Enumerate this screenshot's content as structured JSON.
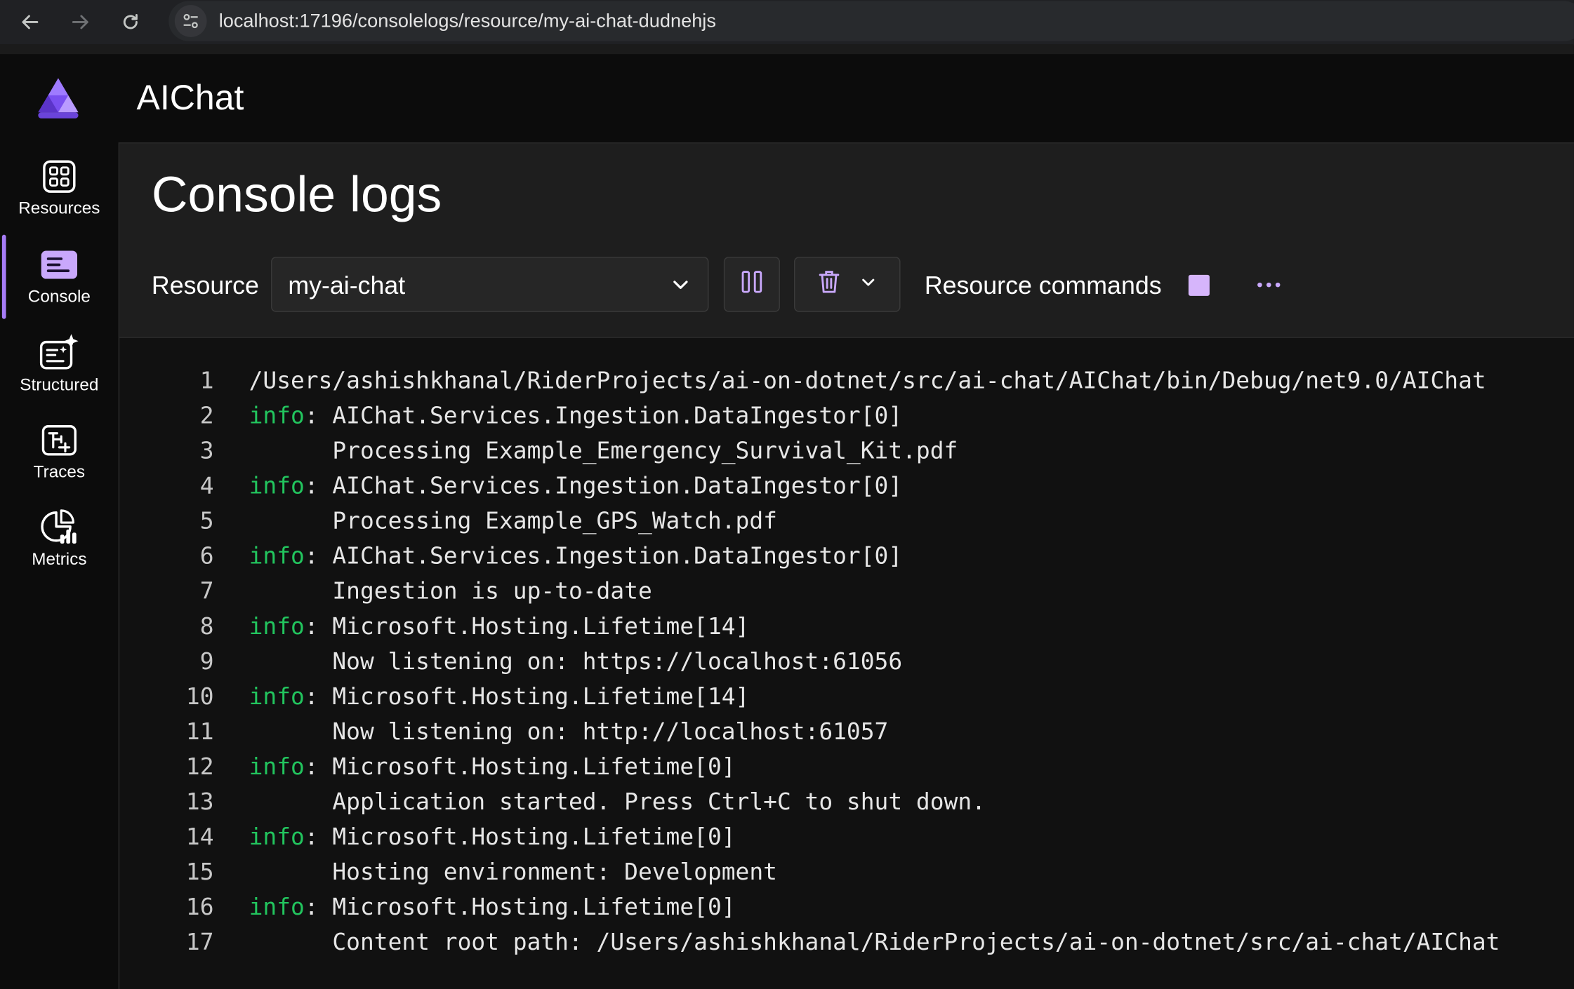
{
  "browser": {
    "url": "localhost:17196/consolelogs/resource/my-ai-chat-dudnehjs"
  },
  "app": {
    "title": "AIChat"
  },
  "sidebar": {
    "items": [
      {
        "label": "Resources",
        "icon": "grid-icon"
      },
      {
        "label": "Console",
        "icon": "console-icon",
        "active": true
      },
      {
        "label": "Structured",
        "icon": "structured-logs-icon"
      },
      {
        "label": "Traces",
        "icon": "traces-icon"
      },
      {
        "label": "Metrics",
        "icon": "metrics-icon"
      }
    ]
  },
  "main": {
    "page_title": "Console logs",
    "resource_label": "Resource",
    "resource_value": "my-ai-chat",
    "resource_commands_label": "Resource commands"
  },
  "colors": {
    "accent": "#a67cf7",
    "info_level": "#22c55e",
    "stop_button": "#d6b5fb"
  },
  "logs": [
    {
      "n": "1",
      "level": "",
      "text": "/Users/ashishkhanal/RiderProjects/ai-on-dotnet/src/ai-chat/AIChat/bin/Debug/net9.0/AIChat"
    },
    {
      "n": "2",
      "level": "info",
      "text": ": AIChat.Services.Ingestion.DataIngestor[0]"
    },
    {
      "n": "3",
      "level": "",
      "text": "      Processing Example_Emergency_Survival_Kit.pdf"
    },
    {
      "n": "4",
      "level": "info",
      "text": ": AIChat.Services.Ingestion.DataIngestor[0]"
    },
    {
      "n": "5",
      "level": "",
      "text": "      Processing Example_GPS_Watch.pdf"
    },
    {
      "n": "6",
      "level": "info",
      "text": ": AIChat.Services.Ingestion.DataIngestor[0]"
    },
    {
      "n": "7",
      "level": "",
      "text": "      Ingestion is up-to-date"
    },
    {
      "n": "8",
      "level": "info",
      "text": ": Microsoft.Hosting.Lifetime[14]"
    },
    {
      "n": "9",
      "level": "",
      "text": "      Now listening on: https://localhost:61056"
    },
    {
      "n": "10",
      "level": "info",
      "text": ": Microsoft.Hosting.Lifetime[14]"
    },
    {
      "n": "11",
      "level": "",
      "text": "      Now listening on: http://localhost:61057"
    },
    {
      "n": "12",
      "level": "info",
      "text": ": Microsoft.Hosting.Lifetime[0]"
    },
    {
      "n": "13",
      "level": "",
      "text": "      Application started. Press Ctrl+C to shut down."
    },
    {
      "n": "14",
      "level": "info",
      "text": ": Microsoft.Hosting.Lifetime[0]"
    },
    {
      "n": "15",
      "level": "",
      "text": "      Hosting environment: Development"
    },
    {
      "n": "16",
      "level": "info",
      "text": ": Microsoft.Hosting.Lifetime[0]"
    },
    {
      "n": "17",
      "level": "",
      "text": "      Content root path: /Users/ashishkhanal/RiderProjects/ai-on-dotnet/src/ai-chat/AIChat"
    }
  ]
}
